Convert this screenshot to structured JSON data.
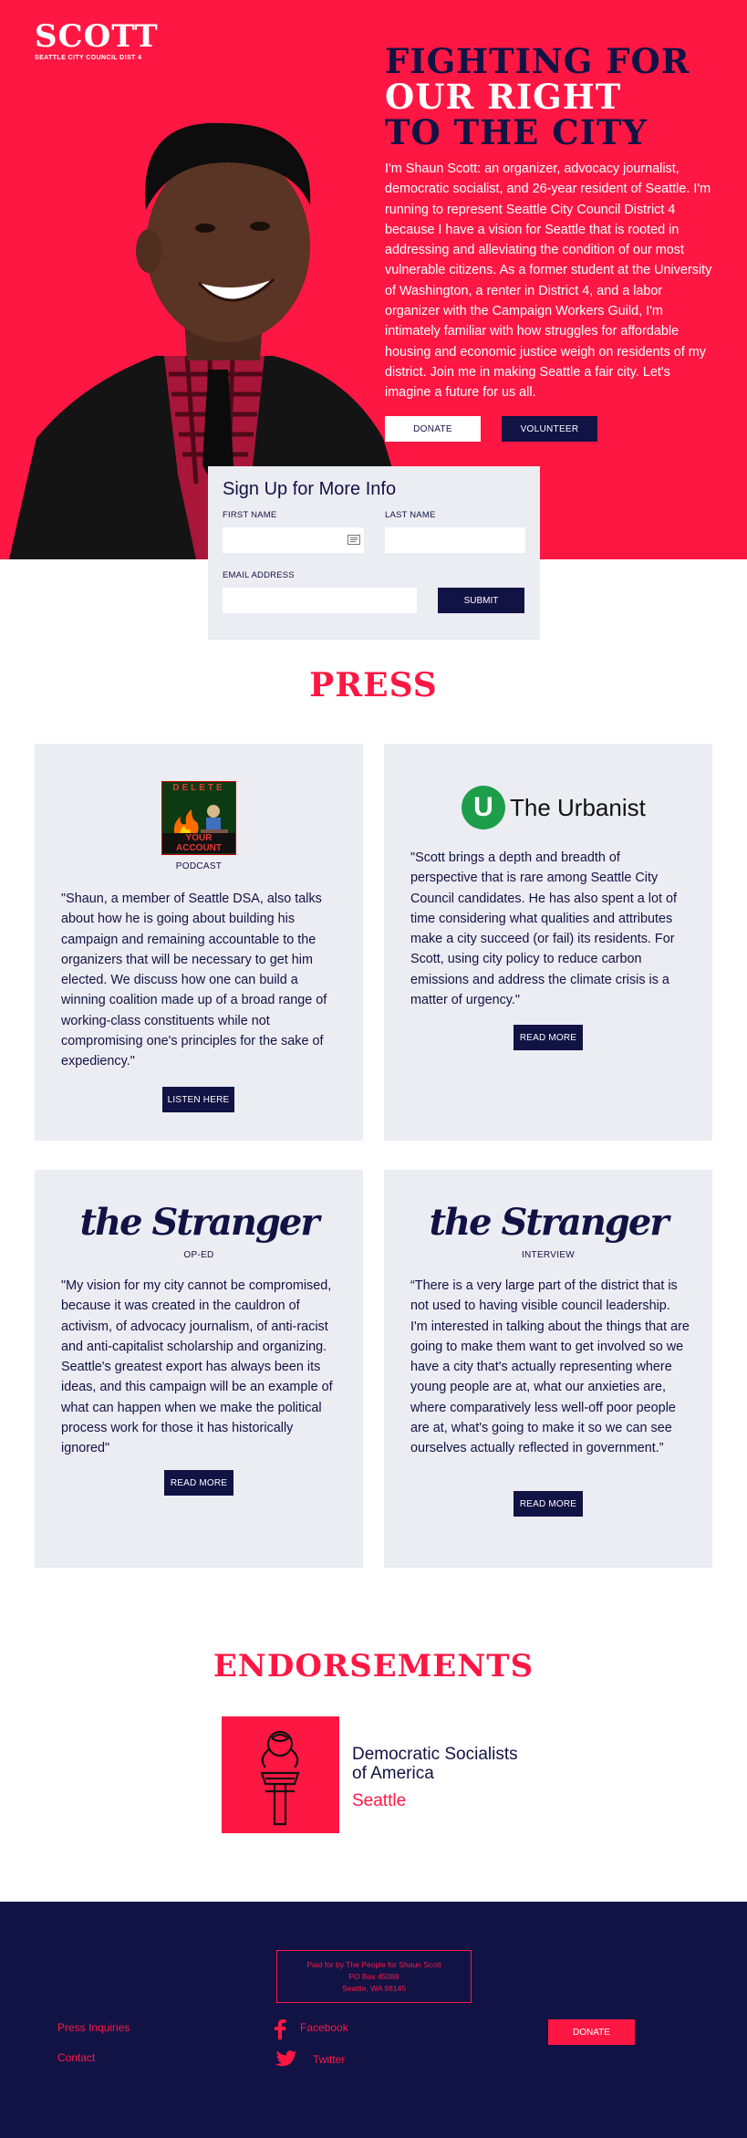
{
  "brand": {
    "name": "SCOTT",
    "subtitle": "SEATTLE CITY COUNCIL DIST 4"
  },
  "hero": {
    "headline_1": "FIGHTING FOR",
    "headline_2": "OUR RIGHT",
    "headline_3": "TO THE CITY",
    "bio": "I'm Shaun Scott: an organizer, advocacy journalist, democratic socialist, and 26-year resident of Seattle. I'm running to represent Seattle City Council District 4 because I have a vision for Seattle that is rooted in addressing and alleviating the condition of our most vulnerable citizens. As a former student at the University of Washington, a renter in District 4, and a labor organizer with the Campaign Workers Guild, I'm intimately familiar with how struggles for affordable housing and economic justice weigh on residents of my district. Join me in making Seattle a fair city. Let's imagine a future for us all.",
    "donate_label": "DONATE",
    "volunteer_label": "VOLUNTEER"
  },
  "signup": {
    "title": "Sign Up for More Info",
    "first_name_label": "FIRST NAME",
    "last_name_label": "LAST NAME",
    "email_label": "EMAIL ADDRESS",
    "first_name_value": "",
    "last_name_value": "",
    "email_value": "",
    "submit_label": "SUBMIT"
  },
  "press": {
    "title": "PRESS",
    "cards": [
      {
        "logo_top": "DELETE",
        "logo_bottom": "YOUR ACCOUNT",
        "kind": "PODCAST",
        "quote": "\"Shaun, a member of Seattle DSA, also talks about how he is going about building his campaign and remaining accountable to the organizers that will be necessary to get him elected. We discuss how one can build a winning coalition made up of a broad range of working-class constituents while not compromising one's principles for the sake of expediency.\"",
        "button": "LISTEN HERE"
      },
      {
        "logo_letter": "U",
        "logo_text": "The Urbanist",
        "quote": "\"Scott brings a depth and breadth of perspective that is rare among Seattle City Council candidates. He has also spent a lot of time considering what qualities and attributes make a city succeed (or fail) its residents. For Scott, using city policy to reduce carbon emissions and address the climate crisis is a matter of urgency.\"",
        "button": "READ MORE"
      },
      {
        "logo_text": "the Stranger",
        "kind": "OP-ED",
        "quote": "\"My vision for my city cannot be compromised, because it was created in the cauldron of activism, of advocacy journalism, of anti-racist and anti-capitalist scholarship and organizing. Seattle's greatest export has always been its ideas, and this campaign will be an example of what can happen when we make the political process work for those it has historically ignored\"",
        "button": "READ MORE"
      },
      {
        "logo_text": "the Stranger",
        "kind": "INTERVIEW",
        "quote": "“There is a very large part of the district that is not used to having visible council leadership. I'm interested in talking about the things that are going to make them want to get involved so we have a city that's actually representing where young people are at, what our anxieties are, where comparatively less well-off poor people are at, what's going to make it so we can see ourselves actually reflected in government.”",
        "button": "READ MORE"
      }
    ]
  },
  "endorsements": {
    "title": "ENDORSEMENTS",
    "org_name": "Democratic Socialists of America",
    "org_city": "Seattle"
  },
  "footer": {
    "paid_line1": "Paid for by The People for Shaun Scott",
    "paid_line2": "PO Box 45088",
    "paid_line3": "Seattle, WA 98145",
    "press_inquiries": "Press Inquiries",
    "contact": "Contact",
    "facebook": "Facebook",
    "twitter": "Twitter",
    "donate_label": "DONATE"
  },
  "colors": {
    "accent_red": "#ff1744",
    "navy": "#111344",
    "card_bg": "#ececf3",
    "urbanist_green": "#1e9e4a"
  }
}
